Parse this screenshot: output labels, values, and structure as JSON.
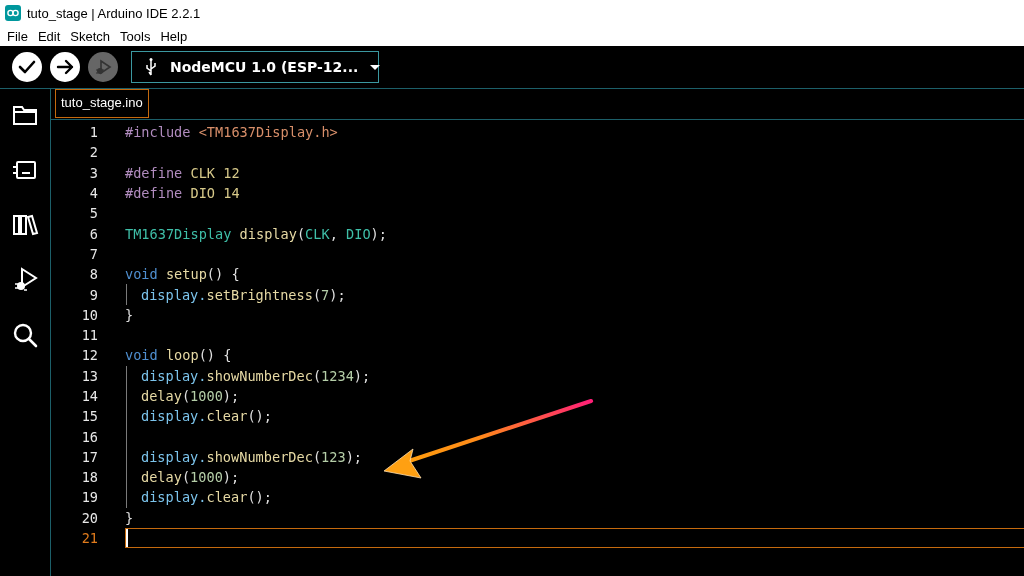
{
  "window": {
    "title": "tuto_stage | Arduino IDE 2.2.1"
  },
  "menu": [
    "File",
    "Edit",
    "Sketch",
    "Tools",
    "Help"
  ],
  "toolbar": {
    "buttons": [
      {
        "kind": "verify",
        "disabled": false
      },
      {
        "kind": "upload",
        "disabled": false
      },
      {
        "kind": "debug",
        "disabled": true
      }
    ],
    "board": "NodeMCU 1.0 (ESP-12..."
  },
  "sidebar": {
    "items": [
      {
        "kind": "folder"
      },
      {
        "kind": "board"
      },
      {
        "kind": "library"
      },
      {
        "kind": "debug"
      },
      {
        "kind": "search"
      }
    ]
  },
  "tabs": [
    {
      "label": "tuto_stage.ino",
      "selected": true
    }
  ],
  "editor": {
    "lines": [
      {
        "number": "1",
        "indent": false,
        "current": false,
        "tokens": [
          {
            "kind": "preproc",
            "text": "#include"
          },
          {
            "kind": "string",
            "text": " <TM1637Display.h>"
          }
        ]
      },
      {
        "number": "2",
        "indent": false,
        "current": false
      },
      {
        "number": "3",
        "indent": false,
        "current": false,
        "tokens": [
          {
            "kind": "preproc",
            "text": "#define"
          },
          {
            "kind": "macro",
            "text": " CLK 12"
          }
        ]
      },
      {
        "number": "4",
        "indent": false,
        "current": false,
        "tokens": [
          {
            "kind": "preproc",
            "text": "#define"
          },
          {
            "kind": "macro",
            "text": " DIO 14"
          }
        ]
      },
      {
        "number": "5",
        "indent": false,
        "current": false
      },
      {
        "number": "6",
        "indent": false,
        "current": false,
        "tokens": [
          {
            "kind": "type",
            "text": "TM1637Display"
          },
          {
            "kind": "func",
            "text": " display"
          },
          {
            "kind": "plain",
            "text": "("
          },
          {
            "kind": "type",
            "text": "CLK"
          },
          {
            "kind": "plain",
            "text": ", "
          },
          {
            "kind": "type",
            "text": "DIO"
          },
          {
            "kind": "plain",
            "text": ");"
          }
        ]
      },
      {
        "number": "7",
        "indent": false,
        "current": false
      },
      {
        "number": "8",
        "indent": false,
        "current": false,
        "tokens": [
          {
            "kind": "keyword",
            "text": "void"
          },
          {
            "kind": "func",
            "text": " setup"
          },
          {
            "kind": "plain",
            "text": "() {"
          }
        ]
      },
      {
        "number": "9",
        "indent": true,
        "current": false,
        "tokens": [
          {
            "kind": "var",
            "text": "display."
          },
          {
            "kind": "func",
            "text": "setBrightness"
          },
          {
            "kind": "plain",
            "text": "("
          },
          {
            "kind": "number",
            "text": "7"
          },
          {
            "kind": "plain",
            "text": ");"
          }
        ]
      },
      {
        "number": "10",
        "indent": false,
        "current": false,
        "tokens": [
          {
            "kind": "plain",
            "text": "}"
          }
        ]
      },
      {
        "number": "11",
        "indent": false,
        "current": false
      },
      {
        "number": "12",
        "indent": false,
        "current": false,
        "tokens": [
          {
            "kind": "keyword",
            "text": "void"
          },
          {
            "kind": "func",
            "text": " loop"
          },
          {
            "kind": "plain",
            "text": "() {"
          }
        ]
      },
      {
        "number": "13",
        "indent": true,
        "current": false,
        "tokens": [
          {
            "kind": "var",
            "text": "display."
          },
          {
            "kind": "func",
            "text": "showNumberDec"
          },
          {
            "kind": "plain",
            "text": "("
          },
          {
            "kind": "number",
            "text": "1234"
          },
          {
            "kind": "plain",
            "text": ");"
          }
        ]
      },
      {
        "number": "14",
        "indent": true,
        "current": false,
        "tokens": [
          {
            "kind": "func",
            "text": "delay"
          },
          {
            "kind": "plain",
            "text": "("
          },
          {
            "kind": "number",
            "text": "1000"
          },
          {
            "kind": "plain",
            "text": ");"
          }
        ]
      },
      {
        "number": "15",
        "indent": true,
        "current": false,
        "tokens": [
          {
            "kind": "var",
            "text": "display."
          },
          {
            "kind": "func",
            "text": "clear"
          },
          {
            "kind": "plain",
            "text": "();"
          }
        ]
      },
      {
        "number": "16",
        "indent": true,
        "current": false
      },
      {
        "number": "17",
        "indent": true,
        "current": false,
        "tokens": [
          {
            "kind": "var",
            "text": "display."
          },
          {
            "kind": "func",
            "text": "showNumberDec"
          },
          {
            "kind": "plain",
            "text": "("
          },
          {
            "kind": "number",
            "text": "123"
          },
          {
            "kind": "plain",
            "text": ");"
          }
        ]
      },
      {
        "number": "18",
        "indent": true,
        "current": false,
        "tokens": [
          {
            "kind": "func",
            "text": "delay"
          },
          {
            "kind": "plain",
            "text": "("
          },
          {
            "kind": "number",
            "text": "1000"
          },
          {
            "kind": "plain",
            "text": ");"
          }
        ]
      },
      {
        "number": "19",
        "indent": true,
        "current": false,
        "tokens": [
          {
            "kind": "var",
            "text": "display."
          },
          {
            "kind": "func",
            "text": "clear"
          },
          {
            "kind": "plain",
            "text": "();"
          }
        ]
      },
      {
        "number": "20",
        "indent": false,
        "current": false,
        "tokens": [
          {
            "kind": "plain",
            "text": "}"
          }
        ]
      },
      {
        "number": "21",
        "indent": false,
        "current": true
      }
    ]
  },
  "annotation": {
    "kind": "arrow"
  }
}
